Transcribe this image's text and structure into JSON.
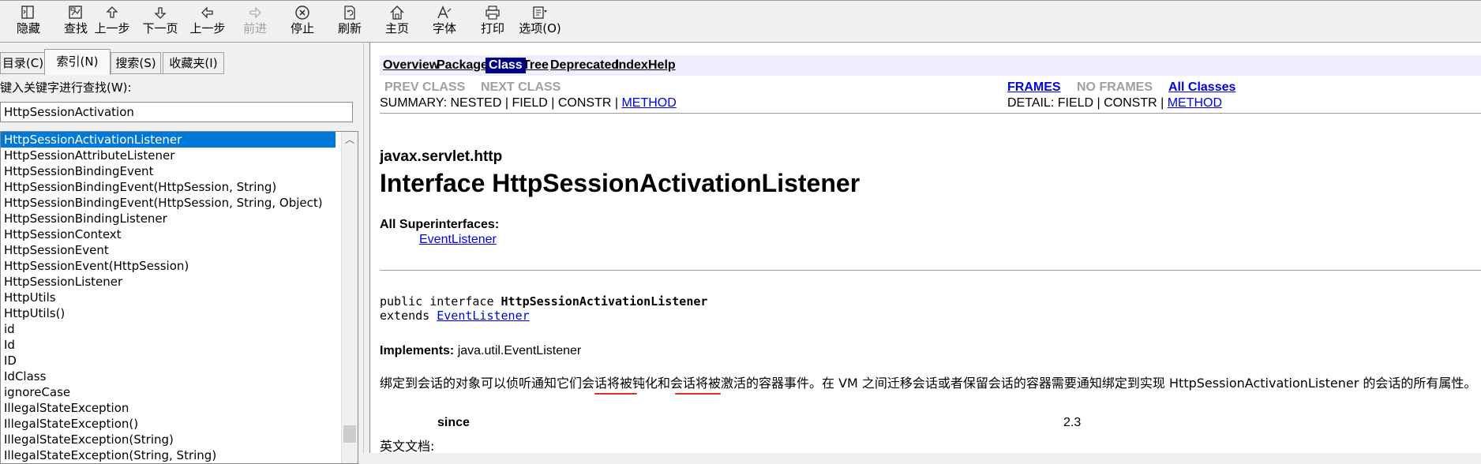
{
  "toolbar": {
    "buttons": [
      {
        "label": "隐藏",
        "icon": "hide-icon"
      },
      {
        "label": "查找",
        "icon": "locate-icon"
      },
      {
        "label": "上一步",
        "icon": "arrow-up-icon"
      },
      {
        "label": "下一页",
        "icon": "arrow-down-icon"
      },
      {
        "label": "上一步",
        "icon": "arrow-left-icon"
      },
      {
        "label": "前进",
        "icon": "arrow-right-icon",
        "disabled": true
      },
      {
        "label": "停止",
        "icon": "stop-icon"
      },
      {
        "label": "刷新",
        "icon": "refresh-icon"
      },
      {
        "label": "主页",
        "icon": "home-icon"
      },
      {
        "label": "字体",
        "icon": "font-icon"
      },
      {
        "label": "打印",
        "icon": "print-icon"
      },
      {
        "label": "选项(O)",
        "icon": "options-icon"
      }
    ]
  },
  "left": {
    "tabs": [
      "目录(C)",
      "索引(N)",
      "搜索(S)",
      "收藏夹(I)"
    ],
    "active_tab": "索引(N)",
    "keyword_label": "键入关键字进行查找(W):",
    "keyword_value": "HttpSessionActivation",
    "items": [
      "HttpSessionActivationListener",
      "HttpSessionAttributeListener",
      "HttpSessionBindingEvent",
      "HttpSessionBindingEvent(HttpSession, String)",
      "HttpSessionBindingEvent(HttpSession, String, Object)",
      "HttpSessionBindingListener",
      "HttpSessionContext",
      "HttpSessionEvent",
      "HttpSessionEvent(HttpSession)",
      "HttpSessionListener",
      "HttpUtils",
      "HttpUtils()",
      "id",
      "Id",
      "ID",
      "IdClass",
      "ignoreCase",
      "IllegalStateException",
      "IllegalStateException()",
      "IllegalStateException(String)",
      "IllegalStateException(String, String)"
    ]
  },
  "doc": {
    "nav": [
      "Overview",
      "Package",
      "Class",
      "Tree",
      "Deprecated",
      "Index",
      "Help"
    ],
    "nav_active": "Class",
    "prev_class": "PREV CLASS",
    "next_class": "NEXT CLASS",
    "frames": "FRAMES",
    "no_frames": "NO FRAMES",
    "all_classes": "All Classes",
    "summary_prefix": "SUMMARY: NESTED | FIELD | CONSTR | ",
    "summary_link": "METHOD",
    "detail_prefix": "DETAIL: FIELD | CONSTR | ",
    "detail_link": "METHOD",
    "package": "javax.servlet.http",
    "title": "Interface HttpSessionActivationListener",
    "supers_label": "All Superinterfaces:",
    "supers_link": "EventListener",
    "decl_prefix": "public interface ",
    "decl_name": "HttpSessionActivationListener",
    "extends_prefix": "extends ",
    "extends_link": "EventListener",
    "impl_label": "Implements:",
    "impl_value": " java.util.EventListener",
    "description": "绑定到会话的对象可以侦听通知它们会话将被钝化和会话将被激活的容器事件。在 VM 之间迁移会话或者保留会话的容器需要通知绑定到实现 HttpSessionActivationListener 的会话的所有属性。",
    "since_label": "since",
    "since_value": "2.3",
    "english_doc": "英文文档:"
  },
  "colors": {
    "selection": "#0078d7",
    "nav_bg": "#eeeeff",
    "nav_active_bg": "#00008b",
    "link": "#0000ee",
    "annotation": "#d8322c"
  }
}
